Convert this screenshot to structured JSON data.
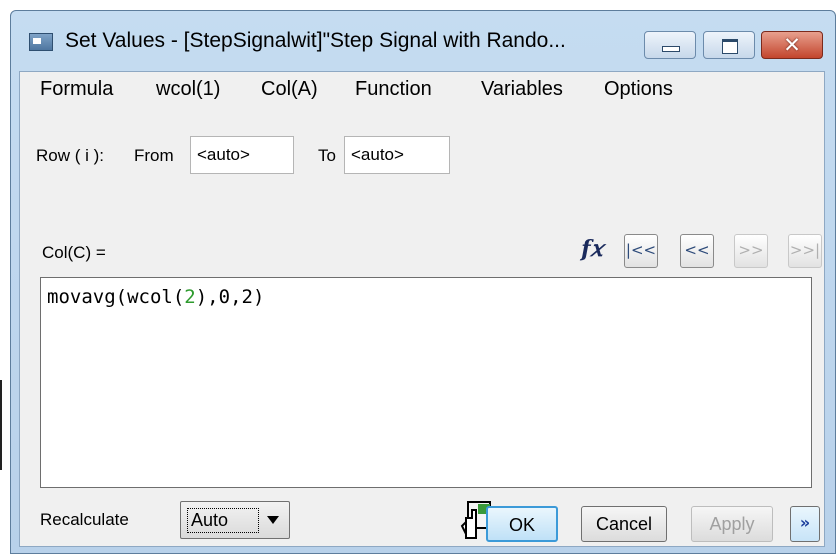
{
  "window": {
    "title": "Set Values - [StepSignalwit]\"Step Signal with Rando...",
    "close_symbol": "✕"
  },
  "menu": [
    "Formula",
    "wcol(1)",
    "Col(A)",
    "Function",
    "Variables",
    "Options"
  ],
  "row_range": {
    "label": "Row ( i ):",
    "from_label": "From",
    "from_value": "<auto>",
    "to_label": "To",
    "to_value": "<auto>"
  },
  "column_label": "Col(C) =",
  "toolbar": {
    "fx_label": "f𝑥",
    "first": "|<<",
    "prev": "<<",
    "next": ">>",
    "last": ">>|"
  },
  "formula": {
    "fn": "movavg(wcol(",
    "arg1": "2",
    "mid": "),",
    "arg2": "0",
    "comma": ",",
    "arg3": "2",
    "end": ")"
  },
  "recalculate": {
    "label": "Recalculate",
    "value": "Auto"
  },
  "buttons": {
    "ok": "OK",
    "cancel": "Cancel",
    "apply": "Apply",
    "expand": "»"
  },
  "colors": {
    "numeric_literal": "#2e9b2e",
    "ok_border": "#3c9ad8"
  }
}
